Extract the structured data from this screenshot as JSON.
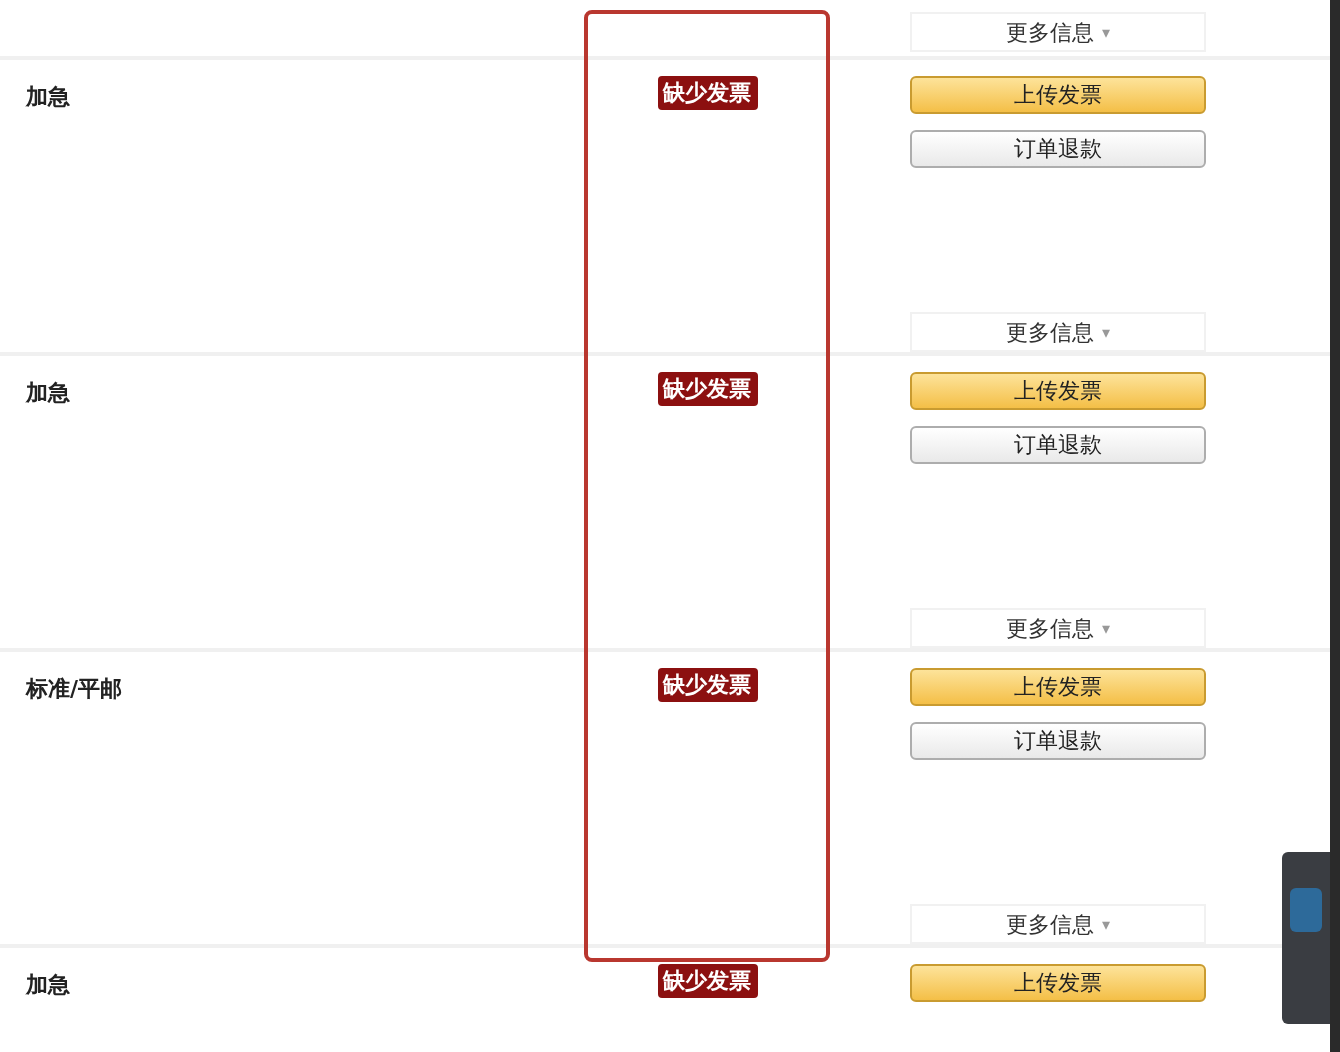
{
  "top_more_info": {
    "label": "更多信息",
    "caret": "▾"
  },
  "rows": [
    {
      "shipping": "加急",
      "badge": "缺少发票",
      "upload": "上传发票",
      "refund": "订单退款",
      "more_info": {
        "label": "更多信息",
        "caret": "▾"
      }
    },
    {
      "shipping": "加急",
      "badge": "缺少发票",
      "upload": "上传发票",
      "refund": "订单退款",
      "more_info": {
        "label": "更多信息",
        "caret": "▾"
      }
    },
    {
      "shipping": "标准/平邮",
      "badge": "缺少发票",
      "upload": "上传发票",
      "refund": "订单退款",
      "more_info": {
        "label": "更多信息",
        "caret": "▾"
      }
    },
    {
      "shipping": "加急",
      "badge": "缺少发票",
      "upload": "上传发票"
    }
  ]
}
